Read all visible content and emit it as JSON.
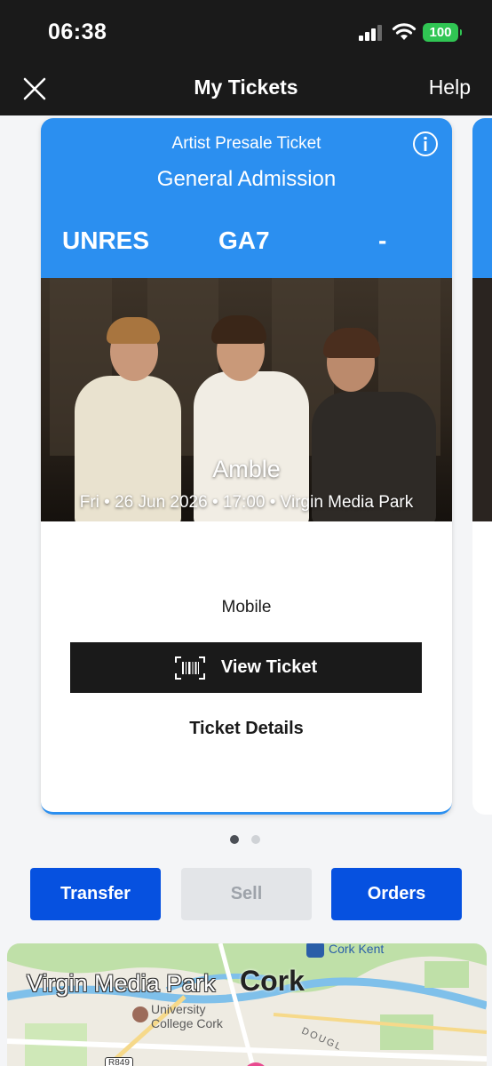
{
  "status_bar": {
    "time": "06:38",
    "battery": "100",
    "icons": [
      "signal-icon",
      "wifi-icon",
      "battery-icon"
    ]
  },
  "nav": {
    "close_icon": "close-icon",
    "title": "My Tickets",
    "help": "Help"
  },
  "ticket": {
    "ticket_type": "Artist Presale Ticket",
    "info_icon": "info-icon",
    "admission": "General Admission",
    "section": "UNRES",
    "row": "GA7",
    "seat": "-",
    "event_name": "Amble",
    "event_meta": "Fri • 26 Jun 2026 • 17:00 • Virgin Media Park",
    "delivery": "Mobile",
    "view_ticket": "View Ticket",
    "barcode_icon": "barcode-icon",
    "ticket_details": "Ticket Details",
    "colors": {
      "header": "#2b8ff0"
    }
  },
  "pager": {
    "pages": 2,
    "active": 1
  },
  "actions": {
    "transfer": "Transfer",
    "sell": "Sell",
    "orders": "Orders",
    "colors": {
      "primary": "#0651e0",
      "disabled": "#e3e5e8"
    }
  },
  "map": {
    "venue": "Virgin Media Park",
    "city": "Cork",
    "station": "Cork Kent",
    "university": "University College Cork",
    "road": "DOUGL",
    "road_number": "R849"
  }
}
